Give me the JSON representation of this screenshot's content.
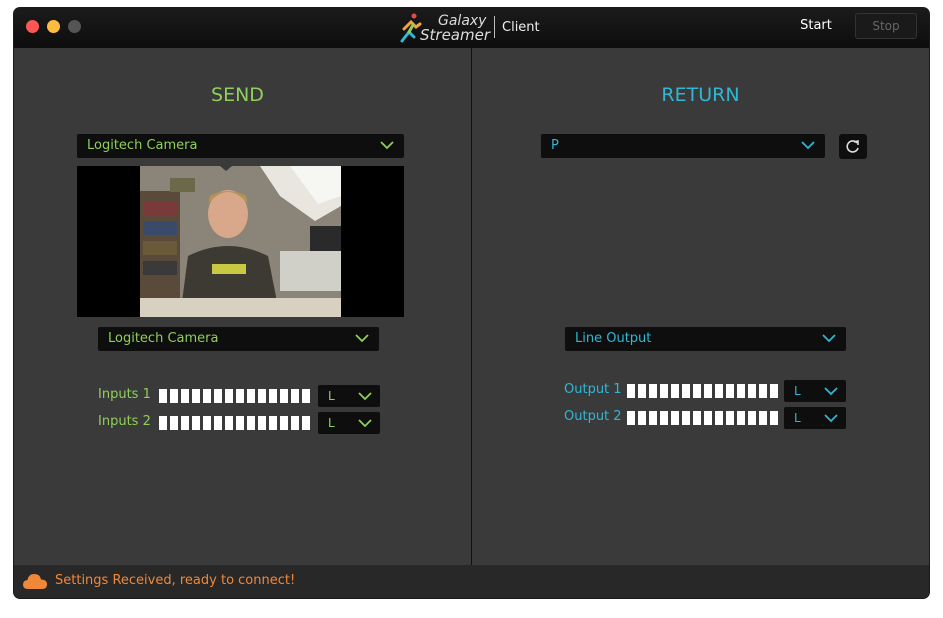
{
  "window": {
    "logo": {
      "line1": "Galaxy",
      "line2": "Streamer"
    },
    "client_label": "Client",
    "start_label": "Start",
    "stop_label": "Stop"
  },
  "send": {
    "title": "SEND",
    "video_source": "Logitech Camera",
    "audio_source": "Logitech Camera",
    "meters": [
      {
        "label": "Inputs 1",
        "channel": "L"
      },
      {
        "label": "Inputs 2",
        "channel": "L"
      }
    ],
    "accent": "#8fcf5a"
  },
  "return": {
    "title": "RETURN",
    "video_source": "P",
    "audio_output": "Line Output",
    "meters": [
      {
        "label": "Output 1",
        "channel": "L"
      },
      {
        "label": "Output 2",
        "channel": "L"
      }
    ],
    "accent": "#2fb7d5"
  },
  "status": {
    "icon": "cloud-icon",
    "text": "Settings Received, ready to connect!",
    "color": "#f0883a"
  }
}
